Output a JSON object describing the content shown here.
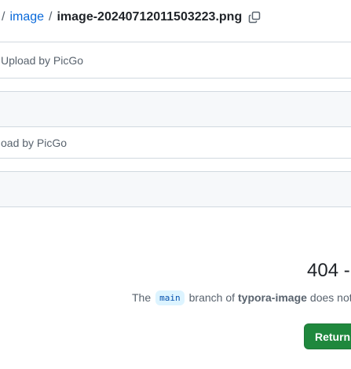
{
  "breadcrumb": {
    "separator": "/",
    "folder": "image",
    "file": "image-20240712011503223.png",
    "copy_icon": "copy-icon"
  },
  "commits": [
    {
      "message": "Upload by PicGo"
    },
    {
      "message": ""
    },
    {
      "message": "oad by PicGo"
    },
    {
      "message": ""
    }
  ],
  "error": {
    "title": "404 -",
    "desc_prefix": "The",
    "branch": "main",
    "desc_middle": "branch of",
    "repo": "typora-image",
    "desc_suffix": "does not",
    "return_button": "Return"
  },
  "colors": {
    "link": "#0969da",
    "primary_button": "#1f883d",
    "muted_text": "#59636e",
    "border": "#d1d9e0",
    "row_gray": "#f6f8fa"
  }
}
